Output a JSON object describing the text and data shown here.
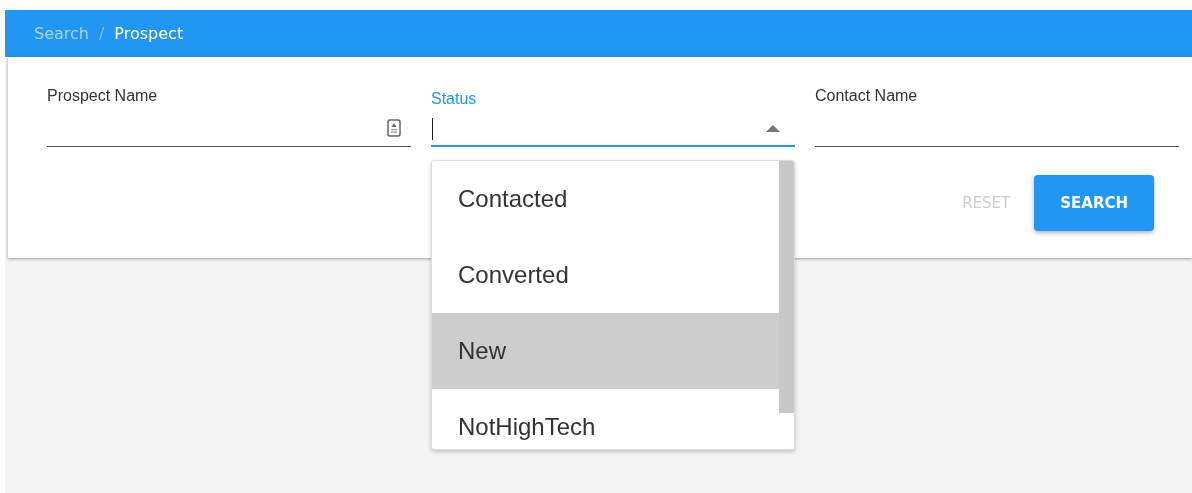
{
  "breadcrumb_separator": "/",
  "breadcrumb": [
    {
      "label": "Search",
      "selected": false
    },
    {
      "label": "Prospect",
      "selected": true
    }
  ],
  "fields": [
    {
      "kind": "text",
      "label": "Prospect Name",
      "focused": false,
      "has_icon": true
    },
    {
      "kind": "select",
      "label": "Status",
      "focused": true,
      "expanded": true
    },
    {
      "kind": "text",
      "label": "Contact Name",
      "focused": false,
      "has_icon": false
    }
  ],
  "buttons": [
    {
      "label": "RESET",
      "kind": "flat",
      "disabled": true
    },
    {
      "label": "SEARCH",
      "kind": "raised",
      "disabled": false
    }
  ],
  "status_menu": [
    {
      "label": "Contacted",
      "selected": false
    },
    {
      "label": "Converted",
      "selected": false
    },
    {
      "label": "New",
      "selected": true
    },
    {
      "label": "NotHighTech",
      "selected": false
    }
  ]
}
